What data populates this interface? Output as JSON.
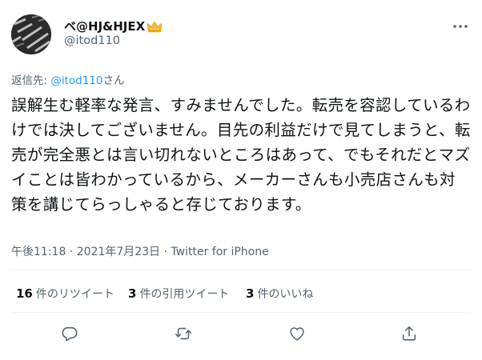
{
  "author": {
    "display_name": "ベ@HJ&HJEX",
    "handle": "@itod110"
  },
  "reply": {
    "prefix": "返信先: ",
    "mention": "@itod110",
    "suffix": "さん"
  },
  "tweet": {
    "text": "誤解生む軽率な発言、すみませんでした。転売を容認しているわけでは決してございません。目先の利益だけで見てしまうと、転売が完全悪とは言い切れないところはあって、でもそれだとマズイことは皆わかっているから、メーカーさんも小売店さんも対策を講じてらっしゃると存じております。",
    "meta": "午後11:18 · 2021年7月23日 · Twitter for iPhone"
  },
  "stats": {
    "retweets_count": "16",
    "retweets_label": "件のリツイート",
    "quotes_count": "3",
    "quotes_label": "件の引用ツイート",
    "likes_count": "3",
    "likes_label": "件のいいね"
  },
  "icons": {
    "more": "more-icon",
    "reply": "reply-icon",
    "retweet": "retweet-icon",
    "like": "like-icon",
    "share": "share-icon",
    "badge": "crown-icon"
  },
  "colors": {
    "link": "#1d9bf0",
    "secondary": "#536471",
    "badge": "#f5b72c"
  }
}
